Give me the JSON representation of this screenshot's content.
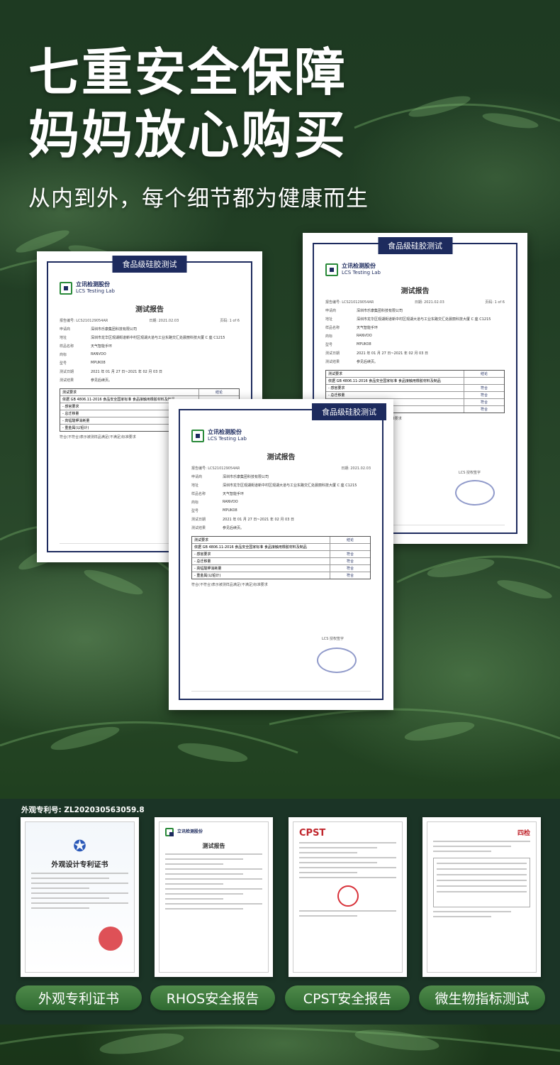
{
  "headline": {
    "line1": "七重安全保障",
    "line2": "妈妈放心购买",
    "subtitle": "从内到外，每个细节都为健康而生"
  },
  "report": {
    "banner": "食品级硅胶测试",
    "lab_cn": "立讯检测股份",
    "lab_en": "LCS Testing Lab",
    "title": "测试报告",
    "report_no_left": "报告编号: LCS210129054AR",
    "report_no_right": "报告编号: LCS210129054AR",
    "date": "日期: 2021.02.03",
    "page": "页码: 1 of 6",
    "fields": [
      {
        "k": "申请商",
        "v": "深圳市乐康集团科技有限公司"
      },
      {
        "k": "地址",
        "v": "深圳市龙华区观湖街道新中村区观湖大道与工业东路交汇处晨丽科技大厦 C 座 C1215"
      },
      {
        "k": "样品名称",
        "v": "天气智能手环"
      },
      {
        "k": "商标",
        "v": "RANVOO"
      },
      {
        "k": "型号",
        "v": "MPUK08"
      },
      {
        "k": "测试日期",
        "v": "2021 年 01 月 27 日~2021 年 02 月 03 日"
      },
      {
        "k": "测试结果",
        "v": "参见后续页。"
      }
    ],
    "table_head": [
      "测试要求",
      "结论"
    ],
    "table_rows": [
      {
        "req": "依据 GB 4806.11-2016 食品安全国家标准 食品接触用橡胶材料及制品",
        "res": ""
      },
      {
        "req": "- 感官要求",
        "res": "符合"
      },
      {
        "req": "- 总迁移量",
        "res": "符合"
      },
      {
        "req": "- 高锰酸钾消耗量",
        "res": "符合"
      },
      {
        "req": "- 重金属(以铅计)",
        "res": "符合"
      }
    ],
    "note": "符合(不符合)表示被测样品满足(不满足)标准要求",
    "stamp_label": "LCS 授权签字"
  },
  "bottom": {
    "patent_no": "外观专利号: ZL202030563059.8",
    "thumbs": [
      {
        "title": "外观设计专利证书",
        "label": "外观专利证书"
      },
      {
        "title": "测试报告",
        "label": "RHOS安全报告"
      },
      {
        "title": "CPST",
        "label": "CPST安全报告"
      },
      {
        "title": "四检",
        "label": "微生物指标测试"
      }
    ]
  }
}
